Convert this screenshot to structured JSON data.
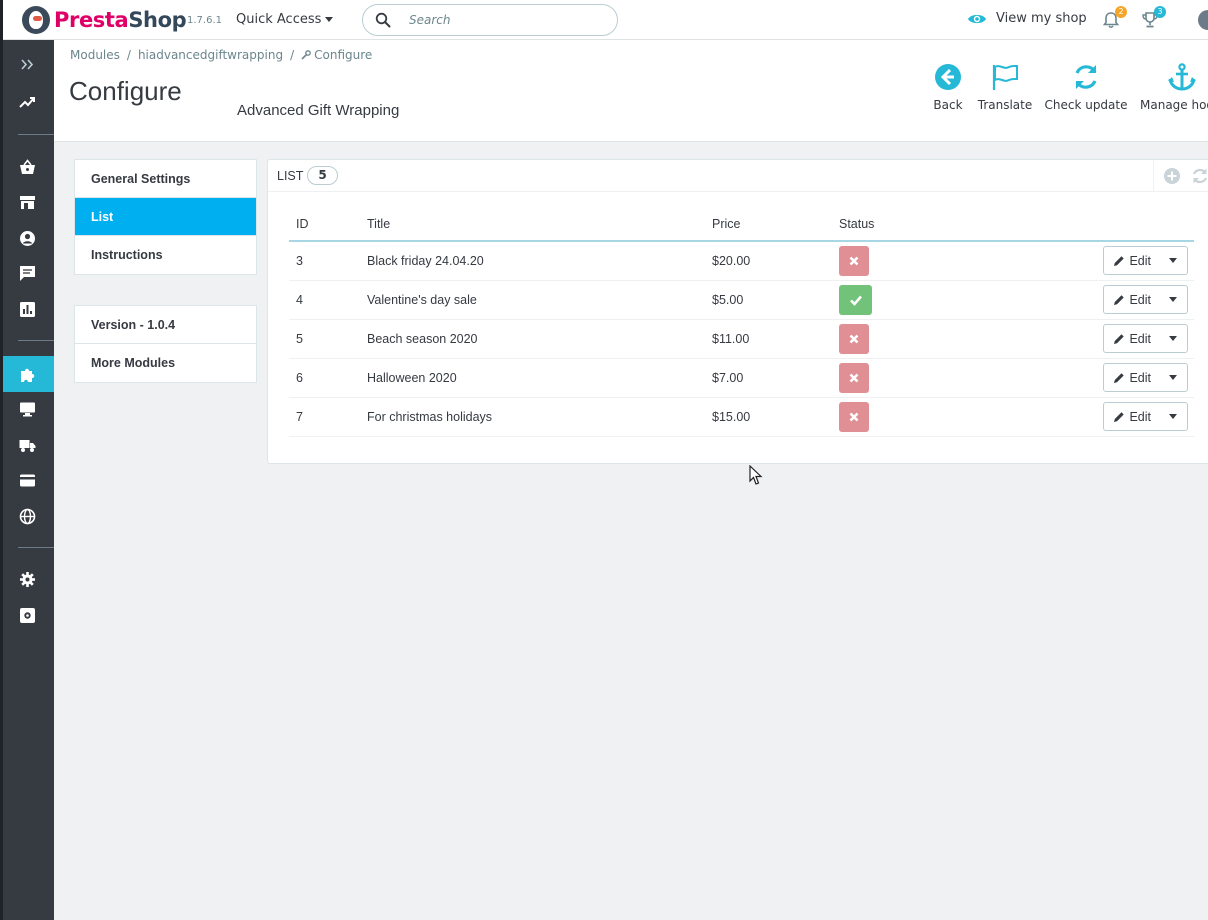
{
  "header": {
    "logo_text_prefix": "Presta",
    "logo_text_suffix": "Shop",
    "version": "1.7.6.1",
    "quick_access": "Quick Access",
    "search_placeholder": "Search",
    "view_shop": "View my shop",
    "notifications_count": "2",
    "orders_count": "3"
  },
  "breadcrumb": {
    "items": [
      "Modules",
      "hiadvancedgiftwrapping",
      "Configure"
    ]
  },
  "page": {
    "title": "Configure",
    "module_name": "Advanced Gift Wrapping"
  },
  "toolbar": {
    "back": "Back",
    "translate": "Translate",
    "check_update": "Check update",
    "manage_hooks": "Manage hooks"
  },
  "nav": {
    "items": [
      "General Settings",
      "List",
      "Instructions"
    ],
    "active": "List",
    "extra": [
      "Version - 1.0.4",
      "More Modules"
    ]
  },
  "list": {
    "title": "LIST",
    "count": "5",
    "columns": [
      "ID",
      "Title",
      "Price",
      "Status"
    ],
    "edit_label": "Edit",
    "rows": [
      {
        "id": "3",
        "title": "Black friday 24.04.20",
        "price": "$20.00",
        "status": "disabled"
      },
      {
        "id": "4",
        "title": "Valentine's day sale",
        "price": "$5.00",
        "status": "enabled"
      },
      {
        "id": "5",
        "title": "Beach season 2020",
        "price": "$11.00",
        "status": "disabled"
      },
      {
        "id": "6",
        "title": "Halloween 2020",
        "price": "$7.00",
        "status": "disabled"
      },
      {
        "id": "7",
        "title": "For christmas holidays",
        "price": "$15.00",
        "status": "disabled"
      }
    ]
  },
  "colors": {
    "accent": "#25b9d7",
    "active_tab": "#00aff0",
    "status_on": "#72c279",
    "status_off": "#e08f95",
    "sidebar": "#363a41"
  }
}
